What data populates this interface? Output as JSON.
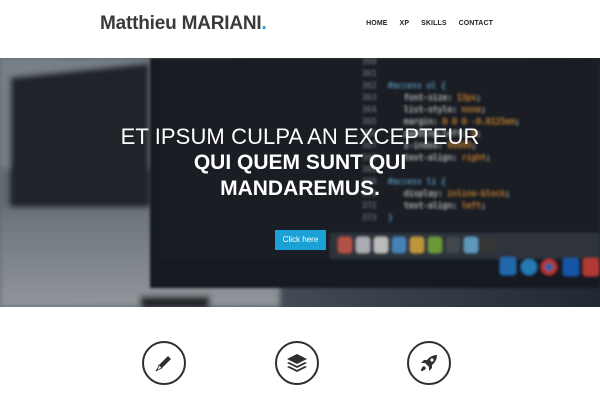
{
  "header": {
    "brand": "Matthieu MARIANI",
    "brand_dot": ".",
    "nav": [
      "HOME",
      "XP",
      "SKILLS",
      "CONTACT"
    ]
  },
  "hero": {
    "line1": "ET IPSUM CULPA AN EXCEPTEUR",
    "line2": "QUI QUEM SUNT QUI",
    "line3": "MANDAREMUS.",
    "cta_label": "Click here"
  },
  "features": {
    "icons": [
      "pen-icon",
      "layers-icon",
      "rocket-icon"
    ]
  },
  "colors": {
    "accent": "#1ba1d6",
    "text_dark": "#3a3a3a"
  }
}
